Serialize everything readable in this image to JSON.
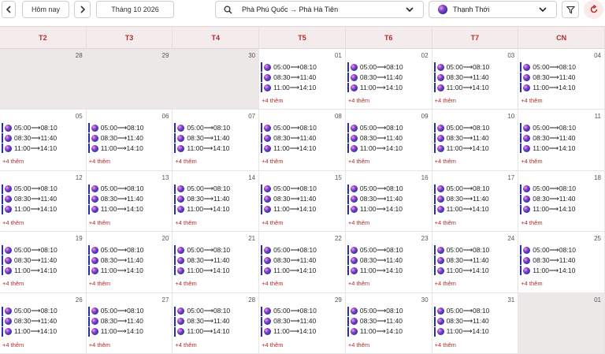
{
  "toolbar": {
    "prev_icon": "chevron-left-icon",
    "today_label": "Hôm nay",
    "next_icon": "chevron-right-icon",
    "month_label": "Tháng 10 2026",
    "route_value": "Phà Phú Quốc → Phà Hà Tiên",
    "vessel_value": "Thạnh Thới",
    "filter_icon": "filter-icon",
    "refresh_icon": "refresh-icon",
    "accent_color": "#b52a2a"
  },
  "weekdays": [
    "T2",
    "T3",
    "T4",
    "T5",
    "T6",
    "T7",
    "CN"
  ],
  "more_label": "+4 thêm",
  "trips": [
    "05:00⟶08:10",
    "08:30⟶11:40",
    "11:00⟶14:10"
  ],
  "weeks": [
    [
      {
        "day": "28",
        "other": true
      },
      {
        "day": "29",
        "other": true
      },
      {
        "day": "30",
        "other": true
      },
      {
        "day": "01",
        "other": false
      },
      {
        "day": "02",
        "other": false
      },
      {
        "day": "03",
        "other": false
      },
      {
        "day": "04",
        "other": false
      }
    ],
    [
      {
        "day": "05",
        "other": false
      },
      {
        "day": "06",
        "other": false
      },
      {
        "day": "07",
        "other": false
      },
      {
        "day": "08",
        "other": false
      },
      {
        "day": "09",
        "other": false
      },
      {
        "day": "10",
        "other": false
      },
      {
        "day": "11",
        "other": false
      }
    ],
    [
      {
        "day": "12",
        "other": false
      },
      {
        "day": "13",
        "other": false
      },
      {
        "day": "14",
        "other": false
      },
      {
        "day": "15",
        "other": false
      },
      {
        "day": "16",
        "other": false
      },
      {
        "day": "17",
        "other": false
      },
      {
        "day": "18",
        "other": false
      }
    ],
    [
      {
        "day": "19",
        "other": false
      },
      {
        "day": "20",
        "other": false
      },
      {
        "day": "21",
        "other": false
      },
      {
        "day": "22",
        "other": false
      },
      {
        "day": "23",
        "other": false
      },
      {
        "day": "24",
        "other": false
      },
      {
        "day": "25",
        "other": false
      }
    ],
    [
      {
        "day": "26",
        "other": false
      },
      {
        "day": "27",
        "other": false
      },
      {
        "day": "28",
        "other": false
      },
      {
        "day": "29",
        "other": false
      },
      {
        "day": "30",
        "other": false
      },
      {
        "day": "31",
        "other": false
      },
      {
        "day": "01",
        "other": true
      }
    ]
  ]
}
